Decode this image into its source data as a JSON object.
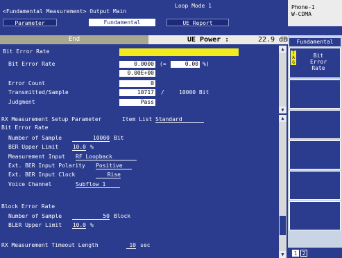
{
  "header": {
    "screen_title": "<Fundamental Measurement> Output Main",
    "mode": "Loop Mode 1",
    "tabs": [
      {
        "label": "Parameter",
        "selected": false
      },
      {
        "label": "Fundamental",
        "selected": true
      },
      {
        "label": "UE Report",
        "selected": false
      }
    ],
    "phone": {
      "line1": "Phone-1",
      "line2": "W-CDMA"
    }
  },
  "status": {
    "call_state": "End",
    "ue_power_label": "UE Power :",
    "ue_power_value": "22.9 dBm"
  },
  "ber_panel": {
    "title": "Bit Error Rate",
    "rows": {
      "ber_label": "Bit Error Rate",
      "ber_value": "0.0000",
      "ber_paren_open": "(=",
      "ber_percent": "0.00",
      "ber_percent_unit": "%)",
      "ber_exp": "0.00E+00",
      "error_count_label": "Error Count",
      "error_count_value": "0",
      "tx_sample_label": "Transmitted/Sample",
      "tx_value": "10717",
      "tx_sep": "/",
      "sample_total": "10000 Bit",
      "judgment_label": "Judgment",
      "judgment_value": "Pass"
    }
  },
  "setup": {
    "header_label": "RX Measurement Setup Parameter",
    "item_list_label": "Item List",
    "item_list_value": "Standard",
    "ber_section": "Bit Error Rate",
    "num_sample_label": "Number of Sample",
    "num_sample_value": "10000",
    "num_sample_unit": "Bit",
    "ber_upper_label": "BER Upper Limit",
    "ber_upper_value": "10.0",
    "ber_upper_unit": "%",
    "meas_input_label": "Measurement Input",
    "meas_input_value": "RF Loopback",
    "ext_pol_label": "Ext. BER Input Polarity",
    "ext_pol_value": "Positive",
    "ext_clk_label": "Ext. BER Input Clock",
    "ext_clk_value": "Rise",
    "voice_label": "Voice Channel",
    "voice_value": "Subflow 1",
    "bler_section": "Block Error Rate",
    "bler_num_label": "Number of Sample",
    "bler_num_value": "50",
    "bler_num_unit": "Block",
    "bler_upper_label": "BLER Upper Limit",
    "bler_upper_value": "10.0",
    "bler_upper_unit": "%",
    "timeout_label": "RX Measurement Timeout Length",
    "timeout_value": "10",
    "timeout_unit": "sec"
  },
  "softkeys": {
    "header": "Fundamental",
    "key1_tag": "T\nA\nG",
    "key1_text": "Bit\nError\nRate",
    "pages": [
      "1",
      "2"
    ]
  },
  "colors": {
    "background": "#2b3b8e",
    "highlight": "#f4ec1a",
    "status_bar": "#ecebe6",
    "softkey_panel": "#c9d4e4"
  }
}
